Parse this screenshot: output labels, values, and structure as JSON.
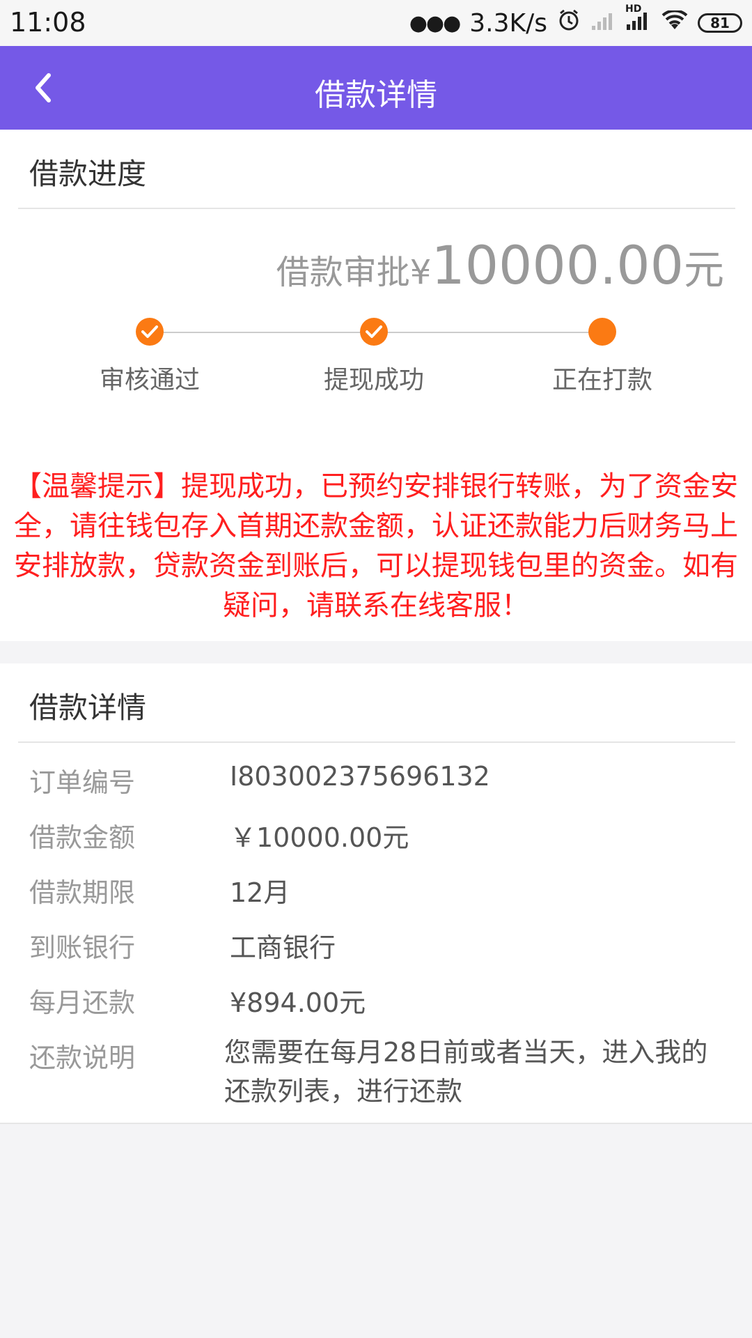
{
  "status_bar": {
    "time": "11:08",
    "network_speed": "3.3K/s",
    "hd_label": "HD",
    "battery": "81"
  },
  "header": {
    "title": "借款详情",
    "back_icon": "chevron-left-icon"
  },
  "progress": {
    "section_title": "借款进度",
    "approval_prefix": "借款审批¥",
    "approval_amount": "10000.00",
    "approval_unit": "元",
    "steps": [
      {
        "label": "审核通过",
        "done": true
      },
      {
        "label": "提现成功",
        "done": true
      },
      {
        "label": "正在打款",
        "done": false
      }
    ],
    "tip": "【温馨提示】提现成功，已预约安排银行转账，为了资金安全，请往钱包存入首期还款金额，认证还款能力后财务马上安排放款，贷款资金到账后，可以提现钱包里的资金。如有疑问，请联系在线客服！"
  },
  "details": {
    "section_title": "借款详情",
    "rows": [
      {
        "label": "订单编号",
        "value": "I803002375696132"
      },
      {
        "label": "借款金额",
        "value": "￥10000.00元"
      },
      {
        "label": "借款期限",
        "value": "12月"
      },
      {
        "label": "到账银行",
        "value": "工商银行"
      },
      {
        "label": "每月还款",
        "value": "¥894.00元"
      },
      {
        "label": "还款说明",
        "value": "您需要在每月28日前或者当天，进入我的还款列表，进行还款"
      }
    ]
  },
  "colors": {
    "header_bg": "#7559e7",
    "accent_orange": "#fb7a13",
    "tip_red": "#ff1f1f"
  }
}
